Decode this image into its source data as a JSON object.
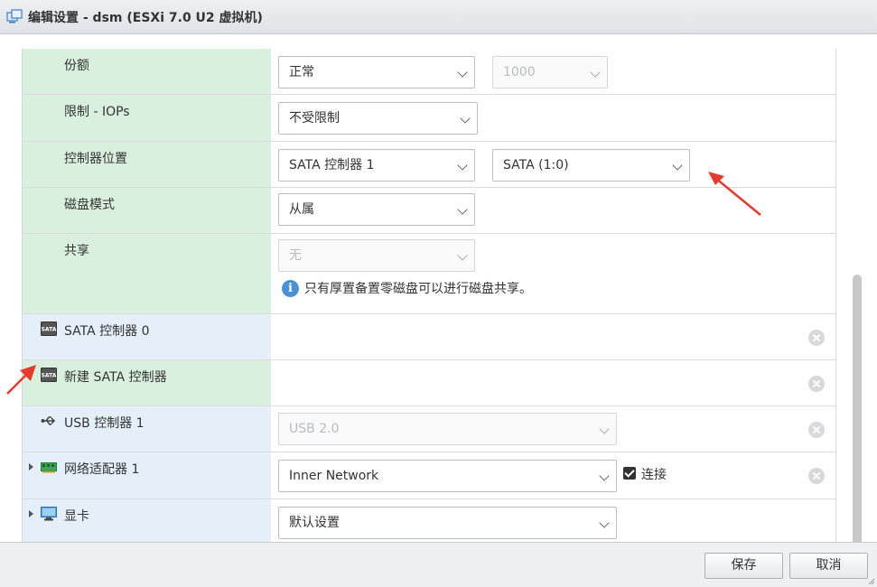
{
  "window": {
    "title": "编辑设置 - dsm (ESXi 7.0 U2 虚拟机)"
  },
  "rows": {
    "share": {
      "label": "份额",
      "select_value": "正常",
      "select2_value": "1000"
    },
    "limit_iops": {
      "label": "限制 - IOPs",
      "select_value": "不受限制"
    },
    "controller_location": {
      "label": "控制器位置",
      "select_value": "SATA 控制器 1",
      "select2_value": "SATA (1:0)"
    },
    "disk_mode": {
      "label": "磁盘模式",
      "select_value": "从属"
    },
    "sharing": {
      "label": "共享",
      "select_value": "无",
      "info_text": "只有厚置备置零磁盘可以进行磁盘共享。"
    },
    "sata0": {
      "label": "SATA 控制器 0",
      "icon_badge": "SATA"
    },
    "sata_new": {
      "label": "新建 SATA 控制器",
      "icon_badge": "SATA"
    },
    "usb1": {
      "label": "USB 控制器 1",
      "select_value": "USB 2.0"
    },
    "nic1": {
      "label": "网络适配器 1",
      "select_value": "Inner Network",
      "connect_label": "连接"
    },
    "display": {
      "label": "显卡",
      "select_value": "默认设置"
    }
  },
  "footer": {
    "save_label": "保存",
    "cancel_label": "取消"
  },
  "colors": {
    "green_label_bg": "#d9f0df",
    "blue_label_bg": "#e4eff9",
    "annotation_arrow": "#e8392f"
  }
}
